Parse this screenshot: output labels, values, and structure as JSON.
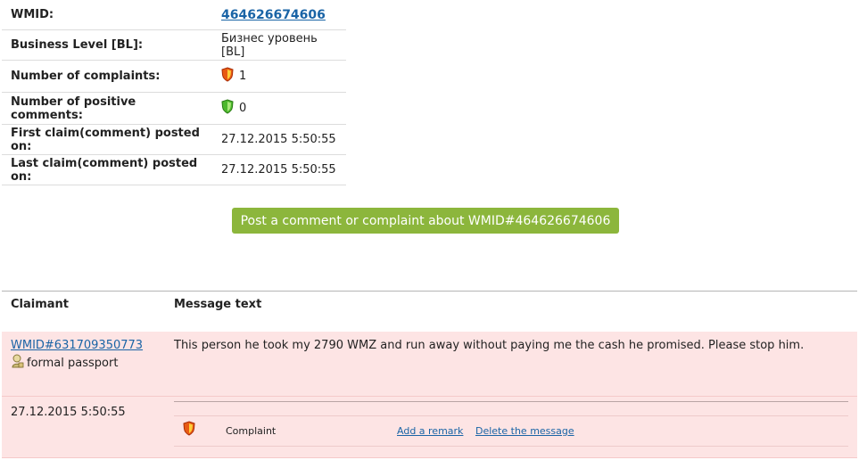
{
  "info": {
    "wmid": {
      "label": "WMID:",
      "value": "464626674606"
    },
    "bl": {
      "label": "Business Level [BL]:",
      "value": "Бизнес уровень [BL]"
    },
    "complaints": {
      "label": "Number of complaints:",
      "value": "1",
      "icon": "red-shield-icon"
    },
    "positive": {
      "label": "Number of positive comments:",
      "value": "0",
      "icon": "green-shield-icon"
    },
    "first": {
      "label": "First claim(comment) posted on:",
      "value": "27.12.2015 5:50:55"
    },
    "last": {
      "label": "Last claim(comment) posted on:",
      "value": "27.12.2015 5:50:55"
    }
  },
  "post_button": "Post a comment or complaint about WMID#464626674606",
  "claims": {
    "headers": {
      "claimant": "Claimant",
      "message": "Message text"
    },
    "entry": {
      "claimant_link": "WMID#631709350773",
      "passport": "formal passport",
      "passport_icon": "passport-icon",
      "message": "This person he took my 2790 WMZ and run away without paying me the cash he promised. Please stop him.",
      "date": "27.12.2015 5:50:55",
      "type": "Complaint",
      "type_icon": "red-shield-icon",
      "add_remark": "Add a remark",
      "delete": "Delete the message"
    }
  },
  "colors": {
    "button": "#8cb63c",
    "link": "#1a64a6",
    "claim_bg": "#fde4e4"
  }
}
